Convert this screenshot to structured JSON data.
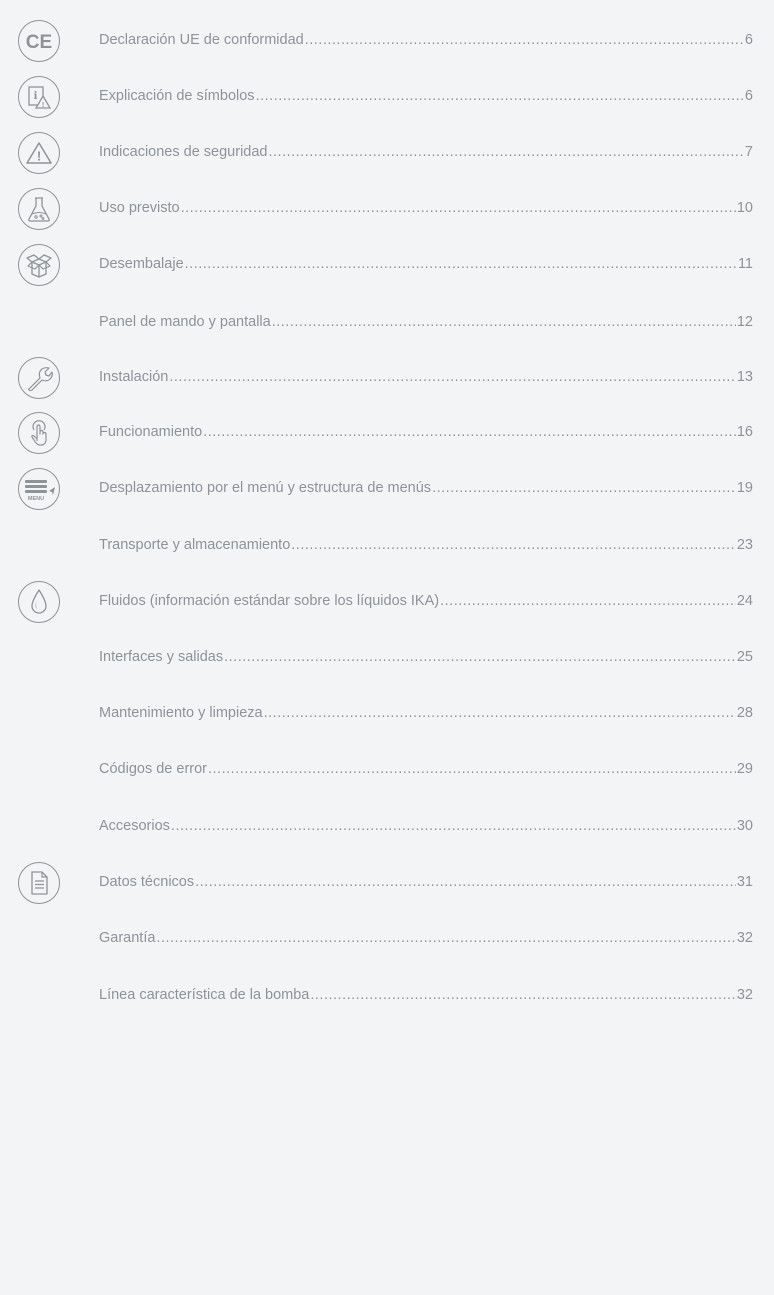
{
  "toc": {
    "entries": [
      {
        "title": "Declaración UE de conformidad",
        "page": "6",
        "icon": "ce-mark-icon"
      },
      {
        "title": "Explicación de símbolos",
        "page": "6",
        "icon": "info-warning-icon"
      },
      {
        "title": "Indicaciones de seguridad",
        "page": "7",
        "icon": "warning-triangle-icon"
      },
      {
        "title": "Uso previsto",
        "page": "10",
        "icon": "flask-icon"
      },
      {
        "title": "Desembalaje",
        "page": "11",
        "icon": "box-icon"
      },
      {
        "title": "Panel de mando y pantalla",
        "page": "12",
        "icon": ""
      },
      {
        "title": "Instalación",
        "page": "13",
        "icon": "wrench-icon"
      },
      {
        "title": "Funcionamiento",
        "page": "16",
        "icon": "touch-icon"
      },
      {
        "title": "Desplazamiento por el menú y estructura de menús ",
        "page": "19",
        "icon": "menu-icon"
      },
      {
        "title": "Transporte y almacenamiento",
        "page": "23",
        "icon": ""
      },
      {
        "title": "Fluidos (información estándar sobre los líquidos IKA)",
        "page": "24",
        "icon": "drop-icon"
      },
      {
        "title": "Interfaces y salidas",
        "page": "25",
        "icon": ""
      },
      {
        "title": "Mantenimiento y limpieza",
        "page": "28",
        "icon": ""
      },
      {
        "title": "Códigos de error",
        "page": "29",
        "icon": ""
      },
      {
        "title": "Accesorios",
        "page": "30",
        "icon": ""
      },
      {
        "title": "Datos técnicos",
        "page": "31",
        "icon": "document-icon"
      },
      {
        "title": "Garantía",
        "page": "32",
        "icon": ""
      },
      {
        "title": "Línea característica de la bomba",
        "page": "32",
        "icon": ""
      }
    ]
  },
  "colors": {
    "text": "#8e9398",
    "background": "#f3f4f6"
  },
  "icon_text": {
    "ce": "CE",
    "info": "i",
    "warn": "!",
    "menu": "MENU"
  }
}
